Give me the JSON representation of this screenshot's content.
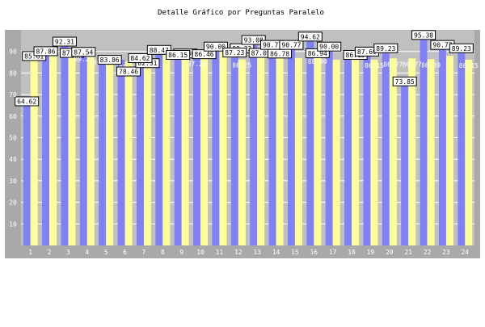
{
  "chart_data": {
    "type": "bar",
    "title": "Detalle Gráfico por Preguntas Paralelo",
    "xlabel": "",
    "ylabel": "",
    "ylim": [
      0,
      100
    ],
    "yticks": [
      10,
      20,
      30,
      40,
      50,
      60,
      70,
      80,
      90
    ],
    "grid": true,
    "legend": "none",
    "colors": {
      "series_a": "#8080f8",
      "series_b": "#ffff99",
      "plot_bg": "#c0c0c0",
      "frame": "#a9a9a9"
    },
    "categories": [
      "1",
      "2",
      "3",
      "4",
      "5",
      "6",
      "7",
      "8",
      "9",
      "10",
      "11",
      "12",
      "13",
      "14",
      "15",
      "16",
      "17",
      "18",
      "19",
      "20",
      "21",
      "22",
      "23",
      "24"
    ],
    "series": [
      {
        "values": [
          64.62,
          87.86,
          92.31,
          89.23,
          87.54,
          86.15,
          84.62,
          88.47,
          86.15,
          86.8,
          90.0,
          87.23,
          93.08,
          90.77,
          90.77,
          94.62,
          90.0,
          86.15,
          87.69,
          89.23,
          73.85,
          95.38,
          90.77,
          89.23
        ]
      },
      {
        "values": [
          85.61,
          87.86,
          87.06,
          89.23,
          83.86,
          85.47,
          82.31,
          88.47,
          87.23,
          86.46,
          90.0,
          86.25,
          87.05,
          86.78,
          86.94,
          88.0,
          86.15,
          86.15,
          86.15,
          86.77,
          86.77,
          86.39,
          88.0,
          86.15
        ]
      }
    ],
    "data_labels": {
      "series_a_boxed": [
        "64.62",
        "87.86",
        "92.31",
        "87.54",
        "",
        "",
        "84.62",
        "88.47",
        "86.15",
        "",
        "90.00",
        "87.23",
        "93.08",
        "90.77",
        "90.77",
        "94.62",
        "90.00",
        "",
        "87.69",
        "89.23",
        "73.85",
        "95.38",
        "90.77",
        "89.23"
      ],
      "series_b_boxed": [
        "85.61",
        "",
        "87.06",
        "",
        "83.86",
        "78.46",
        "82.31",
        "",
        "86.80",
        "86.46",
        "",
        "89.23",
        "87.05",
        "86.78",
        "",
        "86.94",
        "",
        "86.15",
        "",
        "",
        "",
        "",
        "",
        ""
      ],
      "series_a_plain": [
        "",
        "",
        "",
        "89.23",
        "86.51",
        "",
        "",
        "",
        "",
        "87.23",
        "",
        "",
        "",
        "",
        "",
        "",
        "",
        "",
        "",
        "",
        "",
        "",
        "",
        ""
      ],
      "series_b_plain": [
        "",
        "",
        "",
        "",
        "",
        "85.47",
        "",
        "",
        "",
        "",
        "",
        "86.25",
        "",
        "",
        "",
        "88.00",
        "",
        "",
        "86.15",
        "86.77",
        "86.77",
        "86.39",
        "",
        "86.15"
      ]
    }
  }
}
